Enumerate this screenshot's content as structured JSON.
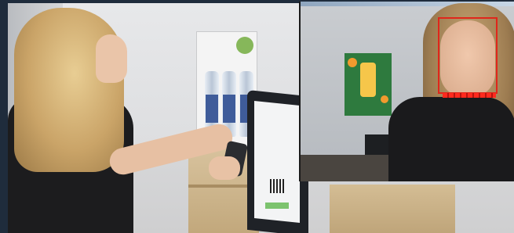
{
  "image": {
    "description_elements": [
      "woman-scanning-phone",
      "self-service-kiosk",
      "face-detection-inset"
    ]
  },
  "colors": {
    "detection_box": "#e0261b",
    "shirt": "#1c1c1e",
    "counter_wood": "#c2a87c"
  }
}
